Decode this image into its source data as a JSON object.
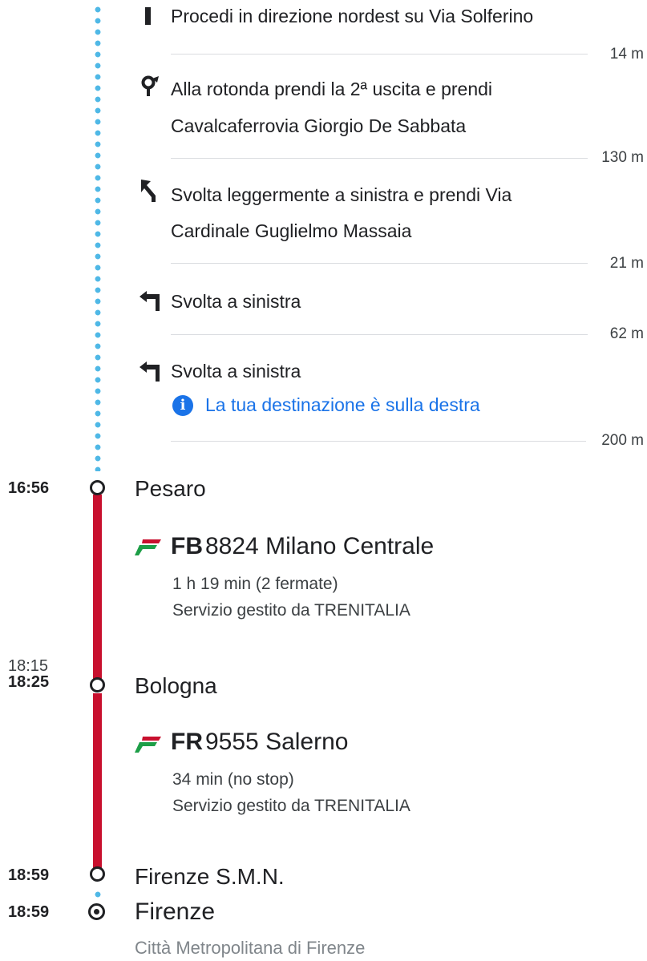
{
  "walking_steps": [
    {
      "instruction": "Procedi in direzione nordest su Via Solferino",
      "distance": "14 m",
      "icon": "straight-arrow-icon"
    },
    {
      "instruction_line1": "Alla rotonda prendi la 2ª uscita e prendi",
      "instruction_line2": "Cavalcaferrovia Giorgio De Sabbata",
      "distance": "130 m",
      "icon": "roundabout-icon"
    },
    {
      "instruction_line1": "Svolta leggermente a sinistra e prendi Via",
      "instruction_line2": "Cardinale Guglielmo Massaia",
      "distance": "21 m",
      "icon": "slight-left-icon"
    },
    {
      "instruction": "Svolta a sinistra",
      "distance": "62 m",
      "icon": "turn-left-icon"
    },
    {
      "instruction": "Svolta a sinistra",
      "note": "La tua destinazione è sulla destra",
      "distance": "200 m",
      "icon": "turn-left-icon"
    }
  ],
  "stops": [
    {
      "time": "16:56",
      "name": "Pesaro"
    },
    {
      "time_scheduled": "18:15",
      "time": "18:25",
      "name": "Bologna"
    },
    {
      "time": "18:59",
      "name": "Firenze S.M.N."
    }
  ],
  "trains": [
    {
      "type": "FB",
      "number_destination": "8824 Milano Centrale",
      "duration": "1 h 19 min (2 fermate)",
      "operator": "Servizio gestito da TRENITALIA"
    },
    {
      "type": "FR",
      "number_destination": "9555 Salerno",
      "duration": "34 min (no stop)",
      "operator": "Servizio gestito da TRENITALIA"
    }
  ],
  "destination": {
    "time": "18:59",
    "name": "Firenze",
    "region": "Città Metropolitana di Firenze"
  },
  "colors": {
    "rail": "#c8102e",
    "walk": "#4fb8e6",
    "link": "#1a73e8"
  }
}
